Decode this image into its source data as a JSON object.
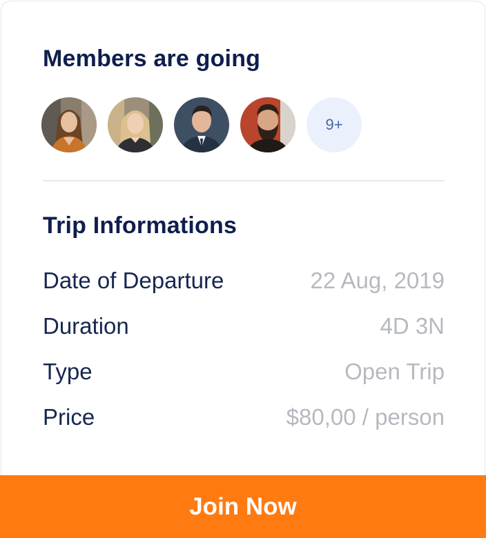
{
  "members": {
    "title": "Members are going",
    "avatars": [
      {
        "name": "member-avatar-1"
      },
      {
        "name": "member-avatar-2"
      },
      {
        "name": "member-avatar-3"
      },
      {
        "name": "member-avatar-4"
      }
    ],
    "more_count": "9+"
  },
  "trip": {
    "title": "Trip Informations",
    "rows": [
      {
        "label": "Date of Departure",
        "value": "22 Aug, 2019"
      },
      {
        "label": "Duration",
        "value": "4D 3N"
      },
      {
        "label": "Type",
        "value": "Open Trip"
      },
      {
        "label": "Price",
        "value": "$80,00 / person"
      }
    ]
  },
  "cta": {
    "label": "Join Now"
  },
  "colors": {
    "title": "#0f1e4d",
    "label": "#16264f",
    "value": "#b6b9bf",
    "accent": "#ff7a11",
    "more_badge_bg": "#eaf1fd"
  }
}
